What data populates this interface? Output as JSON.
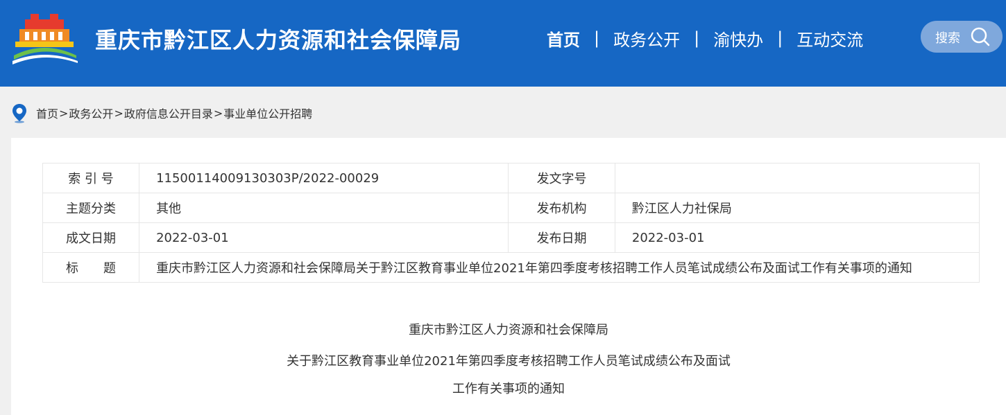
{
  "header": {
    "site_title": "重庆市黔江区人力资源和社会保障局",
    "brand_color": "#1667c4",
    "nav": [
      {
        "label": "首页"
      },
      {
        "label": "政务公开"
      },
      {
        "label": "渝快办"
      },
      {
        "label": "互动交流"
      }
    ],
    "nav_separator": "|",
    "search_label": "搜索",
    "search_icon": "search-icon"
  },
  "breadcrumb": {
    "icon": "location-pin-icon",
    "items": [
      "首页",
      "政务公开",
      "政府信息公开目录",
      "事业单位公开招聘"
    ],
    "separator": ">"
  },
  "meta": {
    "index_label": "索 引 号",
    "index_value": "11500114009130303P/2022-00029",
    "docno_label": "发文字号",
    "docno_value": "",
    "topic_label": "主题分类",
    "topic_value": "其他",
    "issuer_label": "发布机构",
    "issuer_value": "黔江区人力社保局",
    "written_label": "成文日期",
    "written_value": "2022-03-01",
    "published_label": "发布日期",
    "published_value": "2022-03-01",
    "title_label": "标　　题",
    "title_value": "重庆市黔江区人力资源和社会保障局关于黔江区教育事业单位2021年第四季度考核招聘工作人员笔试成绩公布及面试工作有关事项的通知"
  },
  "document": {
    "heading_line1": "重庆市黔江区人力资源和社会保障局",
    "heading_line2": "关于黔江区教育事业单位2021年第四季度考核招聘工作人员笔试成绩公布及面试",
    "heading_line3": "工作有关事项的通知"
  }
}
